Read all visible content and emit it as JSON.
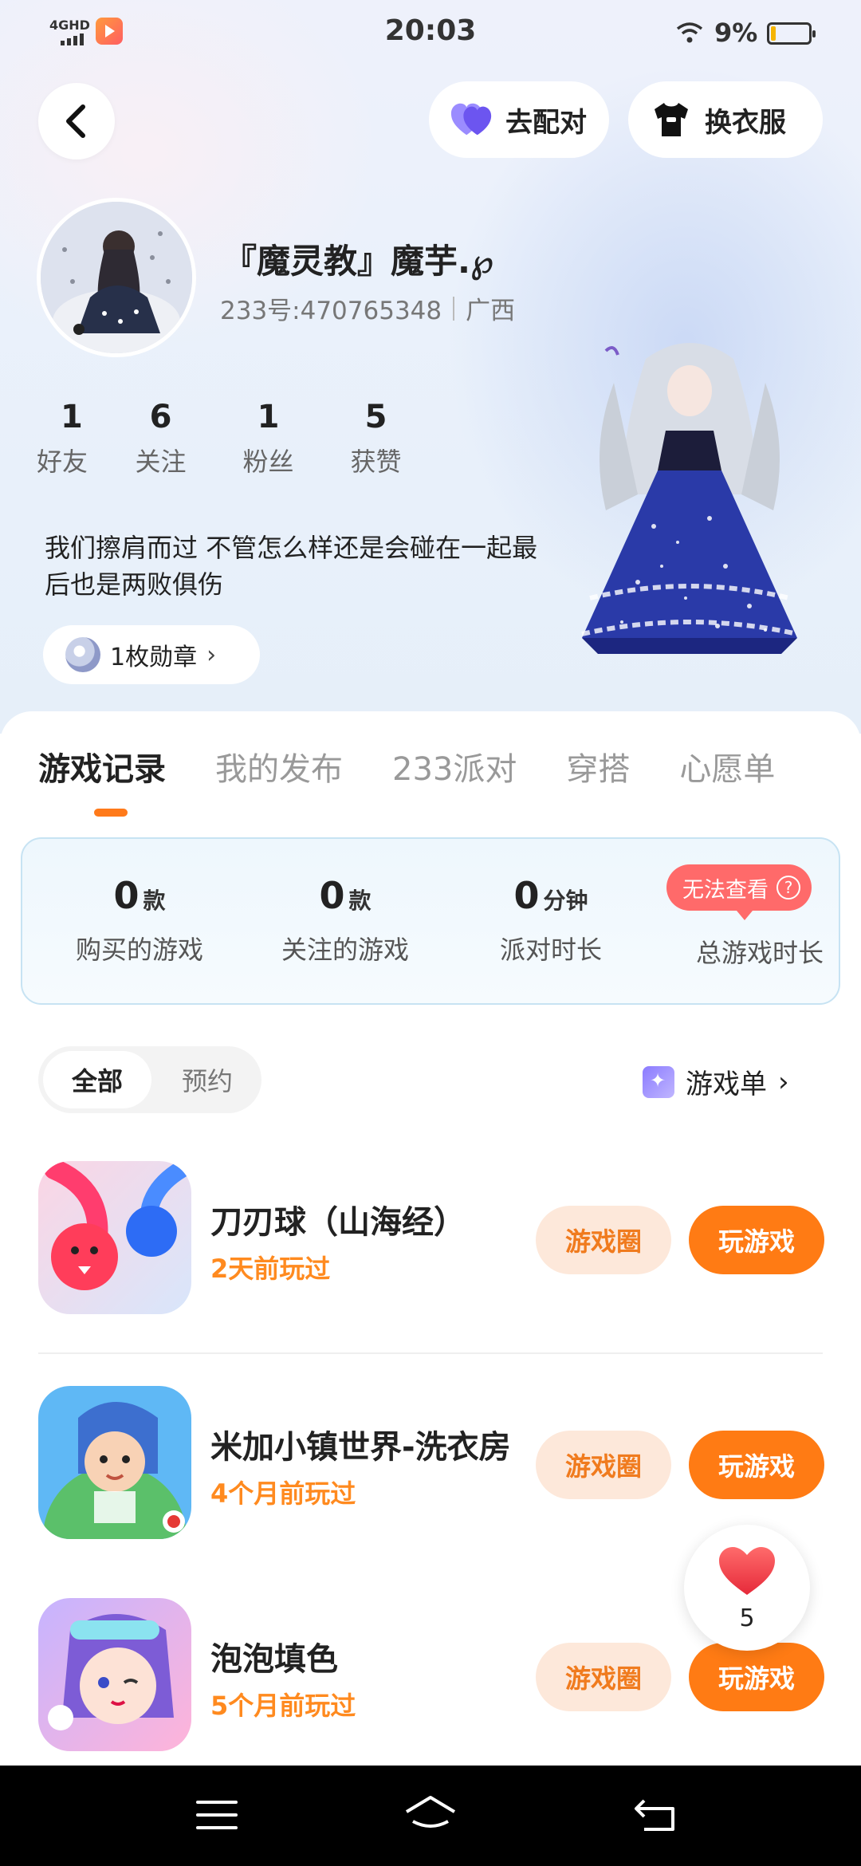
{
  "status_bar": {
    "network": "4GHD",
    "time": "20:03",
    "battery": "9%"
  },
  "header": {
    "match_label": "去配对",
    "dress_label": "换衣服"
  },
  "profile": {
    "username": "『魔灵教』魔芋.℘",
    "uid": "233号:470765348",
    "region": "广西",
    "stats": [
      {
        "value": "1",
        "label": "好友"
      },
      {
        "value": "6",
        "label": "关注"
      },
      {
        "value": "1",
        "label": "粉丝"
      },
      {
        "value": "5",
        "label": "获赞"
      }
    ],
    "bio": "我们擦肩而过 不管怎么样还是会碰在一起最后也是两败俱伤",
    "badges_label": "1枚勋章"
  },
  "tabs": [
    "游戏记录",
    "我的发布",
    "233派对",
    "穿搭",
    "心愿单"
  ],
  "summary": {
    "purchased": {
      "value": "0",
      "unit": "款",
      "label": "购买的游戏"
    },
    "followed": {
      "value": "0",
      "unit": "款",
      "label": "关注的游戏"
    },
    "party": {
      "value": "0",
      "unit": "分钟",
      "label": "派对时长"
    },
    "total": {
      "label": "总游戏时长",
      "warning": "无法查看"
    }
  },
  "filter": {
    "all": "全部",
    "reserve": "预约",
    "gamelist": "游戏单"
  },
  "games": [
    {
      "name": "刀刃球（山海经）",
      "when": "2天前玩过",
      "circle": "游戏圈",
      "play": "玩游戏"
    },
    {
      "name": "米加小镇世界-洗衣房",
      "when": "4个月前玩过",
      "circle": "游戏圈",
      "play": "玩游戏"
    },
    {
      "name": "泡泡填色",
      "when": "5个月前玩过",
      "circle": "游戏圈",
      "play": "玩游戏"
    }
  ],
  "like_count": "5",
  "colors": {
    "accent": "#ff7b14",
    "accent_soft": "#fde8da",
    "warning": "#ff6a6a"
  }
}
